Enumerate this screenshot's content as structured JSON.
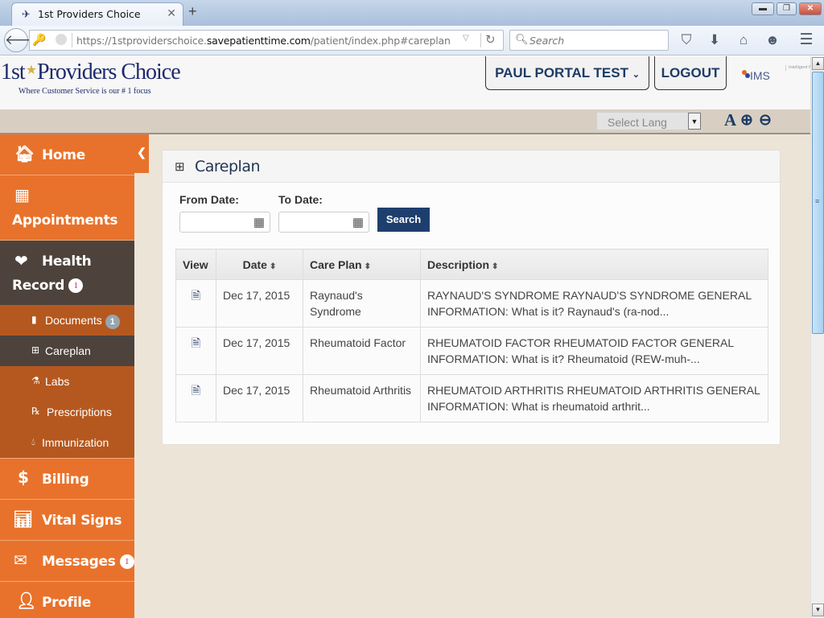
{
  "browser": {
    "tab_title": "1st Providers Choice",
    "url_prefix": "https://1stproviderschoice.",
    "url_domain": "savepatienttime.com",
    "url_path": "/patient/index.php#careplan",
    "search_placeholder": "Search",
    "icons": [
      "back-icon",
      "key-icon",
      "globe-icon",
      "dropdown-icon",
      "reload-icon",
      "search-icon",
      "pocket-icon",
      "download-icon",
      "home-icon",
      "chat-icon",
      "menu-icon"
    ]
  },
  "header": {
    "logo_text_left": "1st",
    "logo_text_right": "Providers Choice",
    "tagline": "Where Customer Service is our # 1 focus",
    "user_menu_label": "PAUL PORTAL TEST",
    "logout_label": "LOGOUT",
    "partner_logo": "IMS",
    "partner_sub": "Intelligent Medical Software"
  },
  "langbar": {
    "select_value": "Select Lang",
    "font_label": "A",
    "zoom_in": "⊕",
    "zoom_out": "⊖"
  },
  "sidebar": {
    "items": [
      {
        "label": "Home",
        "icon": "home-icon"
      },
      {
        "label": "Appointments",
        "icon": "calendar-icon"
      },
      {
        "label_line1": "Health",
        "label_line2": "Record",
        "badge": "1",
        "icon": "heartbeat-icon"
      },
      {
        "label": "Billing",
        "icon": "dollar-icon"
      },
      {
        "label": "Vital Signs",
        "icon": "bar-chart-icon"
      },
      {
        "label": "Messages",
        "badge": "1",
        "icon": "envelope-icon"
      },
      {
        "label": "Profile",
        "icon": "user-icon"
      }
    ],
    "sub_items": [
      {
        "label": "Documents",
        "badge": "1",
        "icon": "file-icon"
      },
      {
        "label": "Careplan",
        "icon": "medkit-icon",
        "active": true
      },
      {
        "label": "Labs",
        "icon": "flask-icon"
      },
      {
        "label": "Prescriptions",
        "icon": "prescription-icon"
      },
      {
        "label": "Immunization",
        "icon": "drop-icon"
      }
    ]
  },
  "main": {
    "title": "Careplan",
    "from_label": "From Date:",
    "to_label": "To Date:",
    "from_value": "",
    "to_value": "",
    "search_label": "Search",
    "table": {
      "headers": [
        "View",
        "Date",
        "Care Plan",
        "Description"
      ],
      "rows": [
        {
          "date": "Dec 17, 2015",
          "plan": "Raynaud's Syndrome",
          "desc": "RAYNAUD'S SYNDROME RAYNAUD'S SYNDROME GENERAL INFORMATION: What is it? Raynaud's (ra-nod..."
        },
        {
          "date": "Dec 17, 2015",
          "plan": "Rheumatoid Factor",
          "desc": "RHEUMATOID FACTOR RHEUMATOID FACTOR GENERAL INFORMATION: What is it? Rheumatoid (REW-muh-..."
        },
        {
          "date": "Dec 17, 2015",
          "plan": "Rheumatoid Arthritis",
          "desc": "RHEUMATOID ARTHRITIS RHEUMATOID ARTHRITIS GENERAL INFORMATION: What is rheumatoid arthrit..."
        }
      ]
    }
  },
  "colors": {
    "sidebar_orange": "#e8722b",
    "submenu_orange": "#b5581f",
    "active_dark": "#4d433c",
    "navy": "#1e3f6e",
    "page_bg": "#ede4d8"
  }
}
